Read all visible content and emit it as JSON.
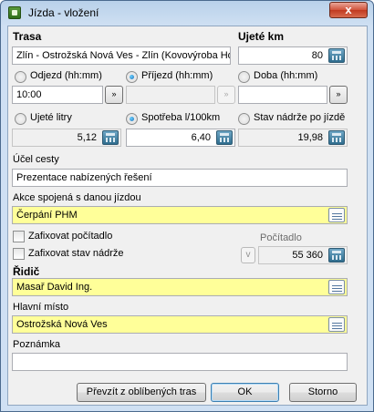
{
  "window": {
    "title": "Jízda - vložení",
    "close_glyph": "x"
  },
  "trasa": {
    "label": "Trasa",
    "value": "Zlín - Ostrožská Nová Ves - Zlín (Kovovýroba Hoff"
  },
  "km": {
    "label": "Ujeté km",
    "value": "80"
  },
  "time": {
    "odjezd_label": "Odjezd (hh:mm)",
    "prijezd_label": "Příjezd (hh:mm)",
    "doba_label": "Doba (hh:mm)",
    "odjezd_value": "10:00",
    "prijezd_value": "",
    "doba_value": "",
    "selected": "prijezd",
    "step_glyph": "»"
  },
  "fuel": {
    "litry_label": "Ujeté litry",
    "spotreba_label": "Spotřeba l/100km",
    "stav_label": "Stav nádrže po jízdě",
    "litry_value": "5,12",
    "spotreba_value": "6,40",
    "stav_value": "19,98",
    "selected": "spotreba"
  },
  "ucel": {
    "label": "Účel cesty",
    "value": "Prezentace nabízených řešení"
  },
  "akce": {
    "label": "Akce spojená s danou jízdou",
    "value": "Čerpání PHM"
  },
  "checks": {
    "pocitadlo_label": "Zafixovat počítadlo",
    "nadrz_label": "Zafixovat stav nádrže",
    "pocitadlo_checked": false,
    "nadrz_checked": false
  },
  "pocitadlo": {
    "label": "Počítadlo",
    "value": "55 360",
    "v_label": "v"
  },
  "ridic": {
    "label": "Řidič",
    "value": "Masař David Ing."
  },
  "misto": {
    "label": "Hlavní místo",
    "value": "Ostrožská Nová Ves"
  },
  "poznamka": {
    "label": "Poznámka",
    "value": ""
  },
  "buttons": {
    "prevzit": "Převzít z oblíbených tras",
    "ok": "OK",
    "storno": "Storno"
  },
  "colors": {
    "highlight_field": "#ffff99",
    "title_bar": "#c9dcf0",
    "close_button": "#c0391f"
  },
  "icons": {
    "calculator": "calculator-icon",
    "list": "list-icon",
    "app": "app-icon"
  }
}
